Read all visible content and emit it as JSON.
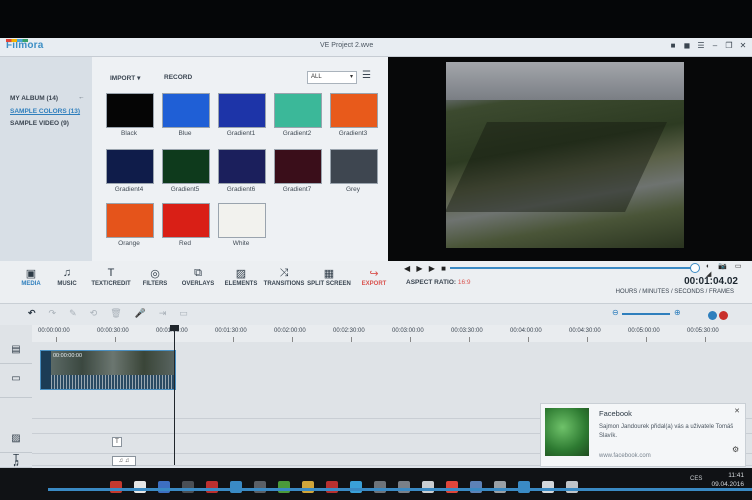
{
  "window": {
    "app_name": "Filmora",
    "title": "VE Project 2.wve",
    "controls": [
      "■",
      "◼",
      "☰",
      "–",
      "❐",
      "✕"
    ]
  },
  "album": {
    "back_icon": "←",
    "items": [
      {
        "label": "MY ALBUM (14)"
      },
      {
        "label": "SAMPLE COLORS (13)"
      },
      {
        "label": "SAMPLE VIDEO (9)"
      }
    ]
  },
  "library": {
    "import_label": "IMPORT ▾",
    "record_label": "RECORD",
    "filter_value": "ALL",
    "menu_icon": "☰",
    "thumbs": [
      {
        "label": "Black",
        "color": "#050505"
      },
      {
        "label": "Blue",
        "color": "#1f5fd6"
      },
      {
        "label": "Gradient1",
        "color": "#1d34a8"
      },
      {
        "label": "Gradient2",
        "color": "#3bb899"
      },
      {
        "label": "Gradient3",
        "color": "#e85a1b"
      },
      {
        "label": "Gradient4",
        "color": "#0f1c4a"
      },
      {
        "label": "Gradient5",
        "color": "#0e3a1c"
      },
      {
        "label": "Gradient6",
        "color": "#1b1f5c"
      },
      {
        "label": "Gradient7",
        "color": "#3a0e1a"
      },
      {
        "label": "Grey",
        "color": "#3e4650"
      },
      {
        "label": "Orange",
        "color": "#e5541b"
      },
      {
        "label": "Red",
        "color": "#d91f16"
      },
      {
        "label": "White",
        "color": "#f2f2ee"
      }
    ]
  },
  "preview": {
    "controls": "◀ ▶ ▶ ■",
    "icons": "◐ 📷 ▭ ◢",
    "aspect_label": "ASPECT RATIO:",
    "aspect_value": "16:9",
    "timecode": "00:01:04.02",
    "timecode_label": "HOURS / MINUTES / SECONDS / FRAMES"
  },
  "toolbar": {
    "items": [
      {
        "label": "MEDIA",
        "icon": "▣"
      },
      {
        "label": "MUSIC",
        "icon": "♫"
      },
      {
        "label": "TEXT/CREDIT",
        "icon": "T"
      },
      {
        "label": "FILTERS",
        "icon": "◎"
      },
      {
        "label": "OVERLAYS",
        "icon": "⧉"
      },
      {
        "label": "ELEMENTS",
        "icon": "▨"
      },
      {
        "label": "TRANSITIONS",
        "icon": "⤨"
      },
      {
        "label": "SPLIT SCREEN",
        "icon": "▦"
      },
      {
        "label": "EXPORT",
        "icon": "↪"
      }
    ]
  },
  "editbar": {
    "undo_icon": "↶",
    "redo_icon": "↷",
    "mic_icon": "🎤"
  },
  "timeline": {
    "ruler": [
      "00:00:00:00",
      "00:00:30:00",
      "00:01:00:00",
      "00:01:30:00",
      "00:02:00:00",
      "00:02:30:00",
      "00:03:00:00",
      "00:03:30:00",
      "00:04:00:00",
      "00:04:30:00",
      "00:05:00:00",
      "00:05:30:00"
    ],
    "clip_name": "00:00:00:00",
    "track_icons": [
      "▤",
      "▭",
      "▨",
      "T",
      "♫",
      "♫"
    ],
    "text_marker": "T",
    "music_marker": "♫ ♫"
  },
  "notification": {
    "title": "Facebook",
    "body": "Sajmon Jandourek přidal(a) vás a uživatele Tomáš Slavík.",
    "url": "www.facebook.com",
    "close": "✕",
    "gear": "⚙"
  },
  "taskbar": {
    "lang": "CES",
    "time": "11:41",
    "date": "09.04.2016",
    "app_colors": [
      "#c5392e",
      "#e5e5e5",
      "#3d6fc1",
      "#4a4f55",
      "#bd2f2f",
      "#3a8ac4",
      "#5a5f66",
      "#4b9a3a",
      "#d0a53a",
      "#b83030",
      "#3aa0d8",
      "#6d737a",
      "#7a8088",
      "#c9cdd1",
      "#e0463b",
      "#5d82b7",
      "#9aa0a6",
      "#3a8ac4",
      "#d3d7db",
      "#c0c4c8"
    ]
  }
}
